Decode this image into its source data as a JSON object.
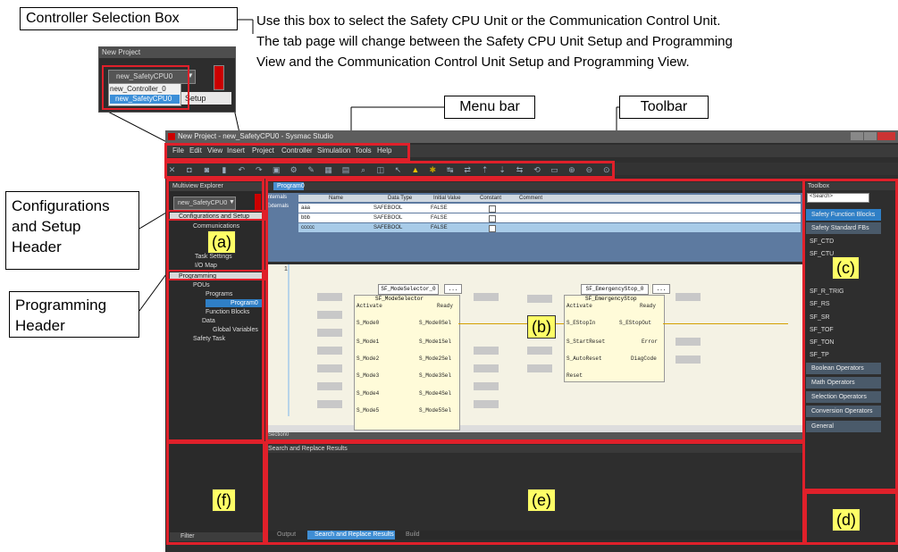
{
  "callouts": {
    "controller_box_label": "Controller Selection Box",
    "controller_note": [
      "Use this box to select the Safety CPU Unit or the Communication Control Unit.",
      "The tab page will change between the Safety CPU Unit Setup and Programming",
      "View and the Communication Control Unit Setup and Programming View."
    ],
    "menu_bar_label": "Menu bar",
    "toolbar_label": "Toolbar",
    "config_header_label": [
      "Configurations",
      "and Setup",
      "Header"
    ],
    "programming_header_label": [
      "Programming",
      "Header"
    ]
  },
  "area_labels": {
    "a": "(a)",
    "b": "(b)",
    "c": "(c)",
    "d": "(d)",
    "e": "(e)",
    "f": "(f)"
  },
  "inset": {
    "title": "New Project",
    "selected": "new_SafetyCPU0",
    "options": [
      "new_Controller_0",
      "new_SafetyCPU0"
    ],
    "tab_fragment": "Setup"
  },
  "window": {
    "title": "New Project - new_SafetyCPU0 - Sysmac Studio",
    "menu": [
      "File",
      "Edit",
      "View",
      "Insert",
      "Project",
      "Controller",
      "Simulation",
      "Tools",
      "Help"
    ]
  },
  "explorer": {
    "title": "Multiview Explorer",
    "controller": "new_SafetyCPU0",
    "config_header": "Configurations and Setup",
    "items_config": [
      "Communications",
      "Task Settings",
      "I/O Map"
    ],
    "prog_header": "Programming",
    "items_prog": [
      "POUs",
      "Programs",
      "Program0",
      "Function Blocks",
      "Data",
      "Global Variables",
      "Safety Task"
    ],
    "filter": "Filter"
  },
  "editor": {
    "tab": "Program0",
    "side_tabs": [
      "Internals",
      "Externals"
    ],
    "columns": [
      "Name",
      "Data Type",
      "Initial Value",
      "Constant",
      "Comment"
    ],
    "rows": [
      {
        "name": "aaa",
        "type": "SAFEBOOL",
        "init": "FALSE"
      },
      {
        "name": "bbb",
        "type": "SAFEBOOL",
        "init": "FALSE"
      },
      {
        "name": "ccccc",
        "type": "SAFEBOOL",
        "init": "FALSE"
      }
    ],
    "rung_number": "1",
    "fb1": {
      "instance": "SF_ModeSelector_0",
      "type": "SF_ModeSelector",
      "inputs": [
        "Activate",
        "S_Mode0",
        "S_Mode1",
        "S_Mode2",
        "S_Mode3",
        "S_Mode4",
        "S_Mode5"
      ],
      "outputs": [
        "Ready",
        "S_Mode0Sel",
        "S_Mode1Sel",
        "S_Mode2Sel",
        "S_Mode3Sel",
        "S_Mode4Sel",
        "S_Mode5Sel"
      ]
    },
    "fb2": {
      "instance": "SF_EmergencyStop_0",
      "type": "SF_EmergencyStop",
      "inputs": [
        "Activate",
        "S_EStopIn",
        "S_StartReset",
        "S_AutoReset",
        "Reset"
      ],
      "outputs": [
        "Ready",
        "S_EStopOut",
        "Error",
        "DiagCode"
      ]
    },
    "ellipsis": "...",
    "status": "Section0"
  },
  "bottom": {
    "title": "Search and Replace Results",
    "tabs": [
      "Output",
      "Search and Replace Results",
      "Build"
    ]
  },
  "toolbox": {
    "title": "Toolbox",
    "search": "<Search>",
    "categories_top": [
      "Safety Function Blocks",
      "Safety Standard FBs"
    ],
    "items": [
      "SF_CTD",
      "SF_CTU",
      "SF_CTUD",
      "SF_F_TRIG",
      "SF_R_TRIG",
      "SF_RS",
      "SF_SR",
      "SF_TOF",
      "SF_TON",
      "SF_TP"
    ],
    "categories_bottom": [
      "Boolean Operators",
      "Math Operators",
      "Selection Operators",
      "Conversion Operators",
      "General"
    ]
  }
}
